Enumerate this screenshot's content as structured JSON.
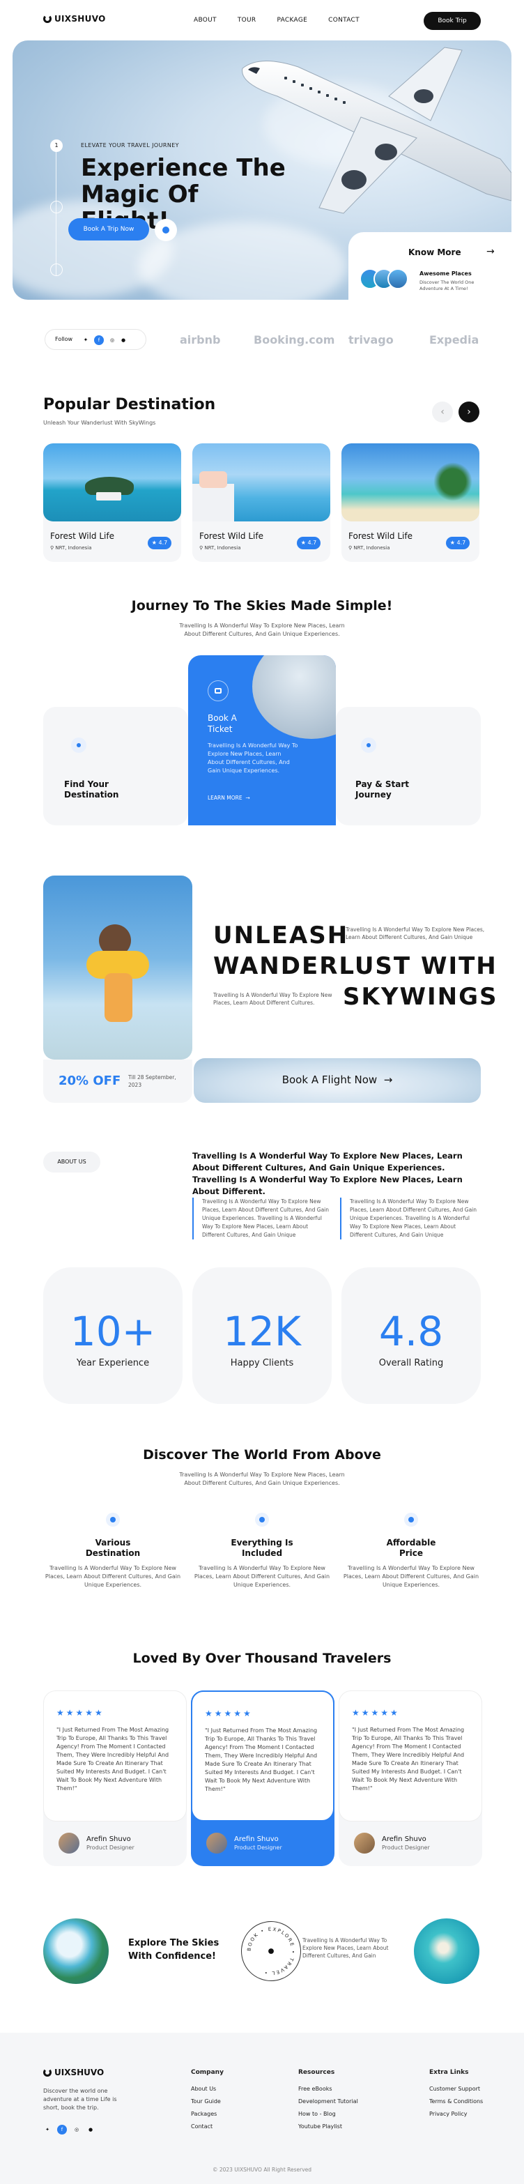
{
  "nav": {
    "logo": "UIXSHUVO",
    "links": [
      "ABOUT",
      "TOUR",
      "PACKAGE",
      "CONTACT"
    ],
    "book_label": "Book Trip"
  },
  "hero": {
    "eyebrow": "ELEVATE YOUR TRAVEL JOURNEY",
    "title": "Experience The Magic Of Flight!",
    "cta": "Book A Trip Now",
    "steps": [
      "1",
      "2",
      "3"
    ],
    "know_more": "Know More",
    "awesome_title": "Awesome Places",
    "awesome_desc": "Discover The World One Adventure At A Time!"
  },
  "follow": {
    "label": "Follow"
  },
  "partners": [
    "airbnb",
    "Booking.com",
    "trivago",
    "Expedia"
  ],
  "popular": {
    "title": "Popular Destination",
    "subtitle": "Unleash Your Wanderlust With SkyWings",
    "cards": [
      {
        "name": "Forest Wild Life",
        "location": "NRT, Indonesia",
        "rating": "4.7"
      },
      {
        "name": "Forest Wild Life",
        "location": "NRT, Indonesia",
        "rating": "4.7"
      },
      {
        "name": "Forest Wild Life",
        "location": "NRT, Indonesia",
        "rating": "4.7"
      }
    ]
  },
  "journey": {
    "title": "Journey To The Skies Made Simple!",
    "subtitle": "Travelling Is A Wonderful Way To Explore New Places, Learn About Different Cultures, And Gain Unique Experiences.",
    "left": "Find Your Destination",
    "center_title": "Book A Ticket",
    "center_desc": "Travelling Is A Wonderful Way To Explore New Places, Learn About Different Cultures, And Gain Unique Experiences.",
    "center_link": "LEARN MORE",
    "right": "Pay & Start Journey"
  },
  "unleash": {
    "line1": "UNLEASH",
    "line2": "WANDERLUST WITH",
    "line3": "SKYWINGS",
    "desc1": "Travelling Is A Wonderful Way To Explore New Places, Learn About Different Cultures, And Gain Unique",
    "desc2": "Travelling Is A Wonderful Way To Explore New Places, Learn About Different Cultures.",
    "discount": "20% OFF",
    "discount_date": "Till 28 September, 2023",
    "book_flight": "Book A Flight Now"
  },
  "about": {
    "tag": "ABOUT US",
    "heading": "Travelling Is A Wonderful Way To Explore New Places, Learn About Different Cultures, And Gain Unique Experiences. Travelling Is A Wonderful Way To Explore New Places, Learn About Different.",
    "col1": "Travelling Is A Wonderful Way To Explore New Places, Learn About Different Cultures, And Gain Unique Experiences. Travelling Is A Wonderful Way To Explore New Places, Learn About Different Cultures, And Gain Unique",
    "col2": "Travelling Is A Wonderful Way To Explore New Places, Learn About Different Cultures, And Gain Unique Experiences. Travelling Is A Wonderful Way To Explore New Places, Learn About Different Cultures, And Gain Unique",
    "stats": [
      {
        "value": "10+",
        "label": "Year Experience"
      },
      {
        "value": "12K",
        "label": "Happy Clients"
      },
      {
        "value": "4.8",
        "label": "Overall Rating"
      }
    ]
  },
  "discover": {
    "title": "Discover The World From Above",
    "subtitle": "Travelling Is A Wonderful Way To Explore New Places, Learn About Different Cultures, And Gain Unique Experiences.",
    "features": [
      {
        "title": "Various Destination",
        "desc": "Travelling Is A Wonderful Way To Explore New Places, Learn About Different Cultures, And Gain Unique Experiences."
      },
      {
        "title": "Everything Is Included",
        "desc": "Travelling Is A Wonderful Way To Explore New Places, Learn About Different Cultures, And Gain Unique Experiences."
      },
      {
        "title": "Affordable Price",
        "desc": "Travelling Is A Wonderful Way To Explore New Places, Learn About Different Cultures, And Gain Unique Experiences."
      }
    ]
  },
  "testimonials": {
    "title": "Loved By Over Thousand Travelers",
    "stars": "★★★★★",
    "items": [
      {
        "quote": "\"I Just Returned From The Most Amazing Trip To Europe, All Thanks To This Travel Agency! From The Moment I Contacted Them, They Were Incredibly Helpful And Made Sure To Create An Itinerary That Suited My Interests And Budget. I Can't Wait To Book My Next Adventure With Them!\"",
        "name": "Arefin Shuvo",
        "role": "Product Designer"
      },
      {
        "quote": "\"I Just Returned From The Most Amazing Trip To Europe, All Thanks To This Travel Agency! From The Moment I Contacted Them, They Were Incredibly Helpful And Made Sure To Create An Itinerary That Suited My Interests And Budget. I Can't Wait To Book My Next Adventure With Them!\"",
        "name": "Arefin Shuvo",
        "role": "Product Designer"
      },
      {
        "quote": "\"I Just Returned From The Most Amazing Trip To Europe, All Thanks To This Travel Agency! From The Moment I Contacted Them, They Were Incredibly Helpful And Made Sure To Create An Itinerary That Suited My Interests And Budget. I Can't Wait To Book My Next Adventure With Them!\"",
        "name": "Arefin Shuvo",
        "role": "Product Designer"
      }
    ]
  },
  "explore": {
    "title": "Explore The Skies With Confidence!",
    "desc": "Travelling Is A Wonderful Way To Explore New Places, Learn About Different Cultures, And Gain",
    "badge": "BOOK • EXPLORE • TRAVEL •"
  },
  "footer": {
    "logo": "UIXSHUVO",
    "tagline": "Discover the world one adventure at a time Life is short, book the trip.",
    "company_title": "Company",
    "company": [
      "About Us",
      "Tour Guide",
      "Packages",
      "Contact"
    ],
    "resources_title": "Resources",
    "resources": [
      "Free eBooks",
      "Development Tutorial",
      "How to - Blog",
      "Youtube Playlist"
    ],
    "extra_title": "Extra Links",
    "extra": [
      "Customer Support",
      "Terms & Conditions",
      "Privacy Policy"
    ],
    "copyright": "© 2023 UIXSHUVO All Right Reserved"
  },
  "colors": {
    "accent": "#2b7ff0",
    "dark": "#111111",
    "light": "#f5f6f8"
  }
}
